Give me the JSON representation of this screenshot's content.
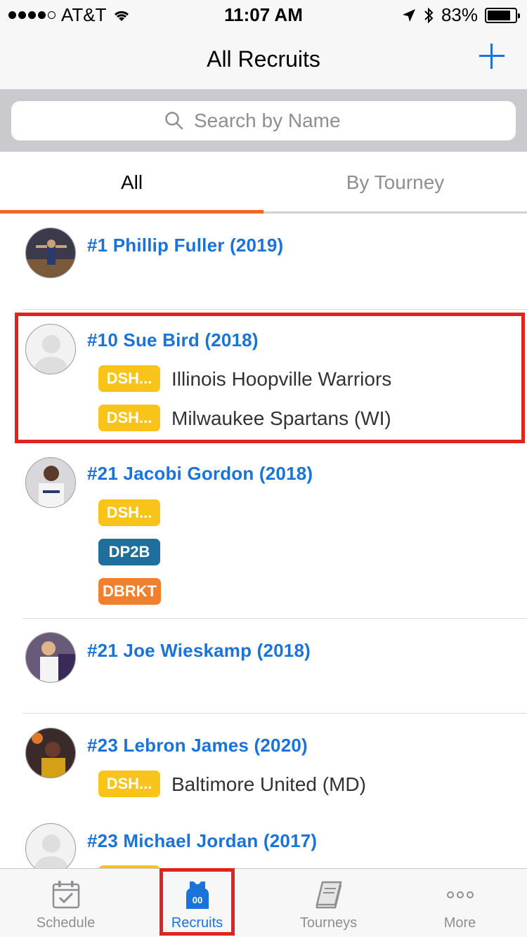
{
  "status_bar": {
    "carrier": "AT&T",
    "time": "11:07 AM",
    "battery": "83%",
    "battery_level": 0.83
  },
  "nav": {
    "title": "All Recruits",
    "add_icon": "plus-icon"
  },
  "search": {
    "placeholder": "Search by Name",
    "value": ""
  },
  "tabs": [
    {
      "label": "All",
      "active": true
    },
    {
      "label": "By Tourney",
      "active": false
    }
  ],
  "recruits": [
    {
      "name": "#1 Phillip Fuller (2019)",
      "tags": []
    },
    {
      "name": "#10 Sue Bird (2018)",
      "tags": [
        {
          "label": "DSH...",
          "team": "Illinois Hoopville Warriors"
        },
        {
          "label": "DSH...",
          "team": "Milwaukee Spartans (WI)"
        }
      ]
    },
    {
      "name": "#21 Jacobi Gordon (2018)",
      "tags": [
        {
          "label": "DSH...",
          "team": ""
        },
        {
          "label": "DP2B",
          "team": ""
        },
        {
          "label": "DBRKT",
          "team": ""
        }
      ]
    },
    {
      "name": "#21 Joe Wieskamp (2018)",
      "tags": []
    },
    {
      "name": "#23 Lebron James (2020)",
      "tags": [
        {
          "label": "DSH...",
          "team": "Baltimore United (MD)"
        }
      ]
    },
    {
      "name": "#23 Michael Jordan (2017)",
      "tags": []
    }
  ],
  "colors": {
    "accent_blue": "#1a73d9",
    "tab_indicator": "#f26522",
    "tag_yellow": "#f8c41a",
    "tag_blue": "#1f6f9e",
    "tag_orange": "#f07f2e",
    "highlight_red": "#e0241b"
  },
  "tab_bar": [
    {
      "label": "Schedule",
      "icon": "calendar-check-icon",
      "active": false
    },
    {
      "label": "Recruits",
      "icon": "jersey-icon",
      "active": true,
      "icon_text": "00"
    },
    {
      "label": "Tourneys",
      "icon": "book-icon",
      "active": false
    },
    {
      "label": "More",
      "icon": "more-dots-icon",
      "active": false
    }
  ]
}
